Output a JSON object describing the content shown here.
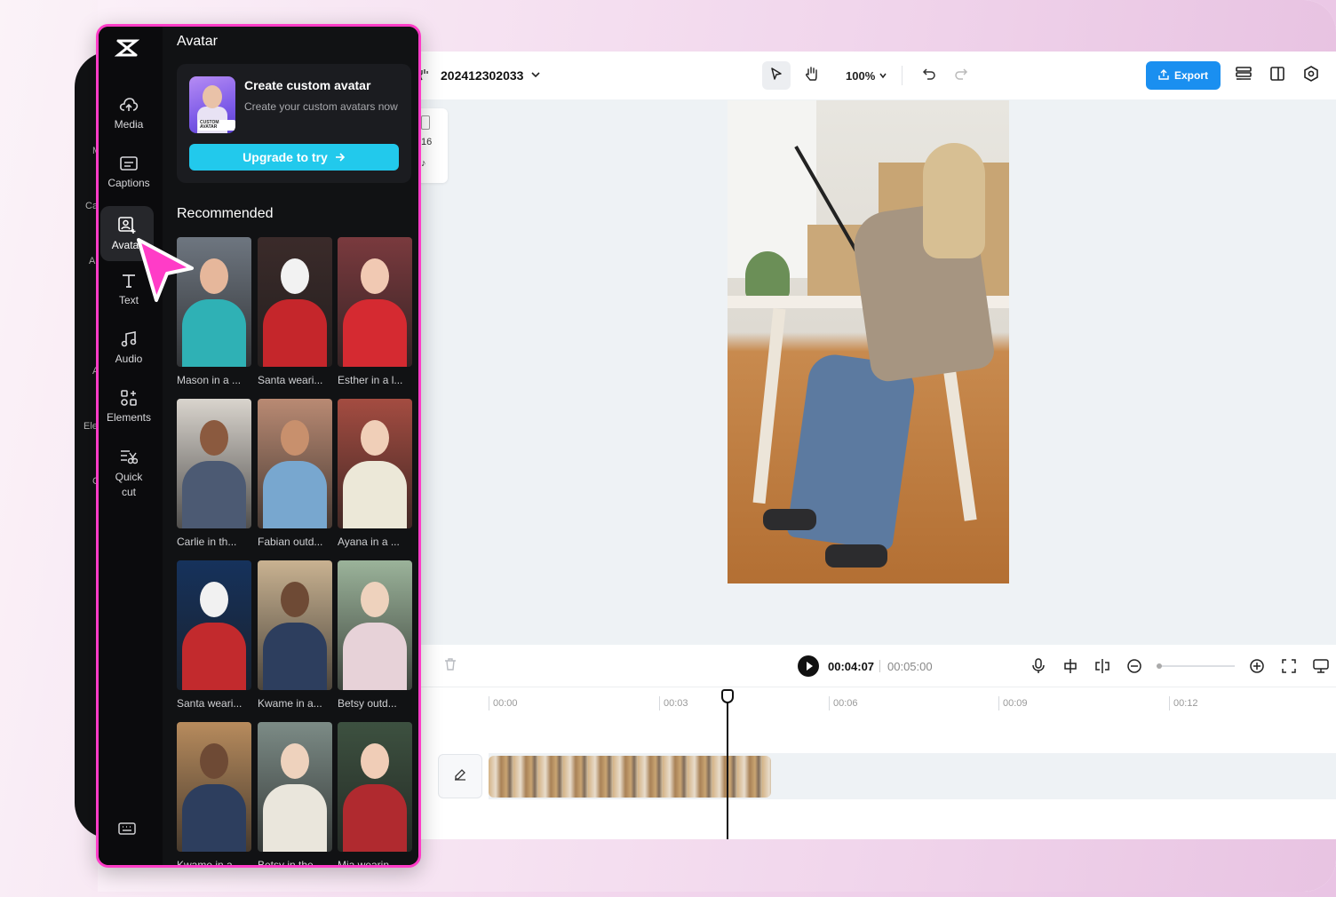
{
  "editor": {
    "project_name": "202412302033",
    "zoom_level": "100%",
    "export_label": "Export",
    "ratio_label": "16",
    "timeline": {
      "current_time": "00:04:07",
      "total_time": "00:05:00",
      "ruler_ticks": [
        "00:00",
        "00:03",
        "00:06",
        "00:09",
        "00:12"
      ]
    }
  },
  "back_rail_labels": [
    "M",
    "Ca",
    "A",
    "A",
    "Ele",
    "C"
  ],
  "rail": {
    "items": [
      {
        "label": "Media",
        "icon": "cloud-upload-icon"
      },
      {
        "label": "Captions",
        "icon": "captions-icon"
      },
      {
        "label": "Avatar",
        "icon": "avatar-icon",
        "active": true
      },
      {
        "label": "Text",
        "icon": "text-icon"
      },
      {
        "label": "Audio",
        "icon": "music-note-icon"
      },
      {
        "label": "Elements",
        "icon": "elements-icon"
      },
      {
        "label": "Quick cut",
        "icon": "quick-cut-icon"
      }
    ]
  },
  "panel": {
    "title": "Avatar",
    "promo": {
      "title": "Create custom avatar",
      "subtitle": "Create your custom avatars now",
      "thumb_tag": "CUSTOM AVATAR",
      "button_label": "Upgrade to try"
    },
    "recommended_title": "Recommended",
    "avatars": [
      {
        "label": "Mason in a ...",
        "bg": "#6e7680",
        "skin": "#e6b79b",
        "cloth": "#2fb1b5"
      },
      {
        "label": "Santa weari...",
        "bg": "#3b2b2a",
        "skin": "#f2f2f2",
        "cloth": "#c5262b"
      },
      {
        "label": "Esther in a l...",
        "bg": "#7a3a3e",
        "skin": "#f1c9b3",
        "cloth": "#d52a31"
      },
      {
        "label": "Carlie in th...",
        "bg": "#d9d4cd",
        "skin": "#8b5a3f",
        "cloth": "#4c5a73"
      },
      {
        "label": "Fabian outd...",
        "bg": "#b98a73",
        "skin": "#c8906d",
        "cloth": "#78a7cf"
      },
      {
        "label": "Ayana in a ...",
        "bg": "#a44c41",
        "skin": "#f0cfb8",
        "cloth": "#ece8d8"
      },
      {
        "label": "Santa weari...",
        "bg": "#16325c",
        "skin": "#f1f1f1",
        "cloth": "#c22a2d"
      },
      {
        "label": "Kwame in a...",
        "bg": "#c9b291",
        "skin": "#6e4a35",
        "cloth": "#2d3e5e"
      },
      {
        "label": "Betsy outd...",
        "bg": "#9bb39a",
        "skin": "#eed2bd",
        "cloth": "#e7d2d8"
      },
      {
        "label": "Kwame in a...",
        "bg": "#b78b5d",
        "skin": "#6e4a35",
        "cloth": "#2d3e5e"
      },
      {
        "label": "Betsy in the...",
        "bg": "#7c8b86",
        "skin": "#eed2bd",
        "cloth": "#eae6dc"
      },
      {
        "label": "Mia wearin...",
        "bg": "#3d5140",
        "skin": "#f0cdb7",
        "cloth": "#b02a2f"
      }
    ]
  },
  "colors": {
    "accent_pink": "#ff3cc7",
    "export_blue": "#1a8ff0",
    "upgrade_cyan": "#22c9ec"
  }
}
